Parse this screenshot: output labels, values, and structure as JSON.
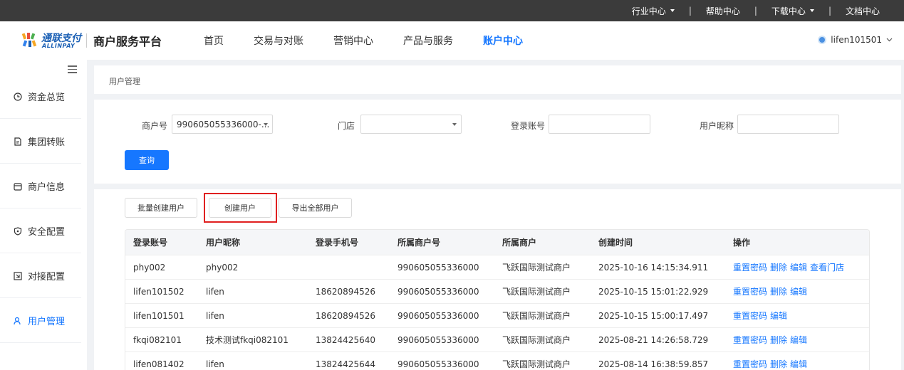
{
  "topbar": {
    "links": [
      {
        "label": "行业中心",
        "dropdown": true
      },
      {
        "label": "帮助中心",
        "dropdown": false
      },
      {
        "label": "下载中心",
        "dropdown": true
      },
      {
        "label": "文档中心",
        "dropdown": false
      }
    ],
    "separator": "|"
  },
  "header": {
    "logo_cn": "通联支付",
    "logo_en": "ALLINPAY",
    "platform_title": "商户服务平台",
    "nav": [
      "首页",
      "交易与对账",
      "营销中心",
      "产品与服务",
      "账户中心"
    ],
    "active_nav": "账户中心",
    "username": "lifen101501"
  },
  "sidebar": {
    "items": [
      {
        "label": "资金总览",
        "icon": "clock-icon"
      },
      {
        "label": "集团转账",
        "icon": "document-icon"
      },
      {
        "label": "商户信息",
        "icon": "store-icon"
      },
      {
        "label": "安全配置",
        "icon": "shield-icon"
      },
      {
        "label": "对接配置",
        "icon": "link-icon"
      },
      {
        "label": "用户管理",
        "icon": "user-icon"
      }
    ],
    "active": "用户管理"
  },
  "breadcrumb": "用户管理",
  "search": {
    "merchant_label": "商户号",
    "merchant_value": "990605055336000-...",
    "store_label": "门店",
    "store_value": "",
    "account_label": "登录账号",
    "account_value": "",
    "nickname_label": "用户昵称",
    "nickname_value": "",
    "query_button": "查询"
  },
  "actions": {
    "batch_create": "批量创建用户",
    "create": "创建用户",
    "export_all": "导出全部用户"
  },
  "table": {
    "columns": [
      "登录账号",
      "用户昵称",
      "登录手机号",
      "所属商户号",
      "所属商户",
      "创建时间",
      "操作"
    ],
    "rows": [
      {
        "account": "phy002",
        "nickname": "phy002",
        "phone": "",
        "merchant_no": "990605055336000",
        "merchant": "飞跃国际测试商户",
        "created": "2025-10-16 14:15:34.911",
        "ops": [
          "重置密码",
          "删除",
          "编辑",
          "查看门店"
        ]
      },
      {
        "account": "lifen101502",
        "nickname": "lifen",
        "phone": "18620894526",
        "merchant_no": "990605055336000",
        "merchant": "飞跃国际测试商户",
        "created": "2025-10-15 15:01:22.929",
        "ops": [
          "重置密码",
          "删除",
          "编辑"
        ]
      },
      {
        "account": "lifen101501",
        "nickname": "lifen",
        "phone": "18620894526",
        "merchant_no": "990605055336000",
        "merchant": "飞跃国际测试商户",
        "created": "2025-10-15 15:00:17.497",
        "ops": [
          "重置密码",
          "编辑"
        ]
      },
      {
        "account": "fkqi082101",
        "nickname": "技术测试fkqi082101",
        "phone": "13824425640",
        "merchant_no": "990605055336000",
        "merchant": "飞跃国际测试商户",
        "created": "2025-08-21 14:26:58.729",
        "ops": [
          "重置密码",
          "删除",
          "编辑"
        ]
      },
      {
        "account": "lifen081402",
        "nickname": "lifen",
        "phone": "13824425644",
        "merchant_no": "990605055336000",
        "merchant": "飞跃国际测试商户",
        "created": "2025-08-14 16:38:59.857",
        "ops": [
          "重置密码",
          "删除",
          "编辑"
        ]
      }
    ]
  },
  "colors": {
    "accent": "#1677ff",
    "topbar": "#3b3b3b",
    "highlight": "#e02020"
  }
}
